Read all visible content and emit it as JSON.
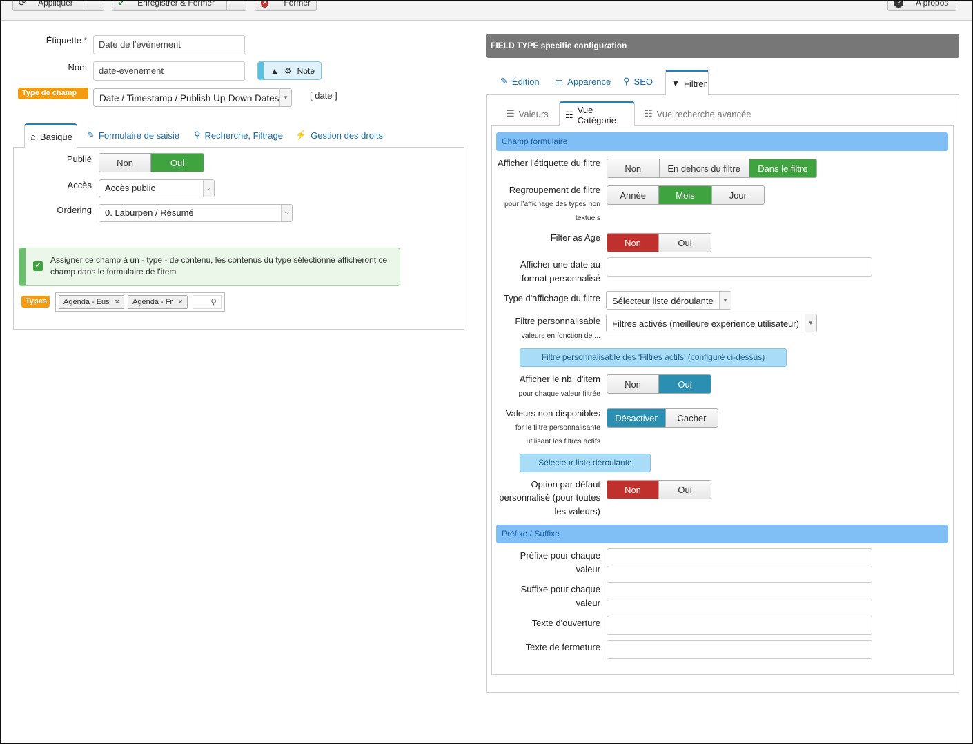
{
  "toolbar": {
    "apply_label": "Appliquer",
    "save_close_label": "Enregistrer & Fermer",
    "close_label": "Fermer",
    "about_label": "A propos"
  },
  "left": {
    "label_field": {
      "label": "Étiquette",
      "required_mark": "*",
      "value": "Date de l'événement"
    },
    "name_field": {
      "label": "Nom",
      "value": "date-evenement"
    },
    "note_button": "Note",
    "field_type": {
      "badge": "Type de champ",
      "value": "Date / Timestamp / Publish Up-Down Dates",
      "code": "[ date ]"
    },
    "tabs": [
      {
        "label": "Basique"
      },
      {
        "label": "Formulaire de saisie"
      },
      {
        "label": "Recherche, Filtrage"
      },
      {
        "label": "Gestion des droits"
      }
    ],
    "published": {
      "label": "Publié",
      "options": [
        "Non",
        "Oui"
      ],
      "selected": "Oui"
    },
    "access": {
      "label": "Accès",
      "value": "Accès public"
    },
    "ordering": {
      "label": "Ordering",
      "value": "0. Laburpen / Résumé"
    },
    "assign_notice": "Assigner ce champ à un - type - de contenu, les contenus du type sélectionné afficheront ce champ dans le formulaire de l'item",
    "types": {
      "badge": "Types",
      "tags": [
        "Agenda - Eus",
        "Agenda - Fr"
      ]
    }
  },
  "right": {
    "panel_title": "FIELD TYPE specific configuration",
    "tabs": [
      {
        "label": "Édition"
      },
      {
        "label": "Apparence"
      },
      {
        "label": "SEO"
      },
      {
        "label": "Filtrer"
      }
    ],
    "subtabs": [
      {
        "label": "Valeurs"
      },
      {
        "label": "Vue Catégorie"
      },
      {
        "label": "Vue recherche avancée"
      }
    ],
    "section1": "Champ formulaire",
    "show_label": {
      "label": "Afficher l'étiquette du filtre",
      "options": [
        "Non",
        "En dehors du filtre",
        "Dans le filtre"
      ],
      "selected": "Dans le filtre"
    },
    "grouping": {
      "label": "Regroupement de filtre",
      "sub1": "pour l'affichage des types non",
      "sub2": "textuels",
      "options": [
        "Année",
        "Mois",
        "Jour"
      ],
      "selected": "Mois"
    },
    "filter_age": {
      "label": "Filter as Age",
      "options": [
        "Non",
        "Oui"
      ],
      "selected": "Non"
    },
    "custom_date": {
      "label1": "Afficher une date au",
      "label2": "format personnalisé",
      "value": ""
    },
    "display_type": {
      "label": "Type d'affichage du filtre",
      "value": "Sélecteur liste déroulante"
    },
    "custom_filter": {
      "label": "Filtre personnalisable",
      "sub": "valeurs en fonction de ...",
      "value": "Filtres activés (meilleure expérience utilisateur)"
    },
    "info_active": "Filtre personnalisable des 'Filtres actifs' (configuré ci-dessus)",
    "show_count": {
      "label": "Afficher le nb. d'item",
      "sub": "pour chaque valeur filtrée",
      "options": [
        "Non",
        "Oui"
      ],
      "selected": "Oui"
    },
    "unavailable": {
      "label": "Valeurs non disponibles",
      "sub1": "for le filtre personnalisante",
      "sub2": "utilisant les filtres actifs",
      "options": [
        "Désactiver",
        "Cacher"
      ],
      "selected": "Désactiver"
    },
    "info_dropdown": "Sélecteur liste déroulante",
    "default_option": {
      "label1": "Option par défaut",
      "label2": "personnalisé (pour toutes",
      "label3": "les valeurs)",
      "options": [
        "Non",
        "Oui"
      ],
      "selected": "Non"
    },
    "section2": "Préfixe / Suffixe",
    "prefix": {
      "label1": "Préfixe pour chaque",
      "label2": "valeur",
      "value": ""
    },
    "suffix": {
      "label1": "Suffixe pour chaque",
      "label2": "valeur",
      "value": ""
    },
    "opening": {
      "label": "Texte d'ouverture",
      "value": ""
    },
    "closing": {
      "label": "Texte de fermeture",
      "value": ""
    }
  }
}
